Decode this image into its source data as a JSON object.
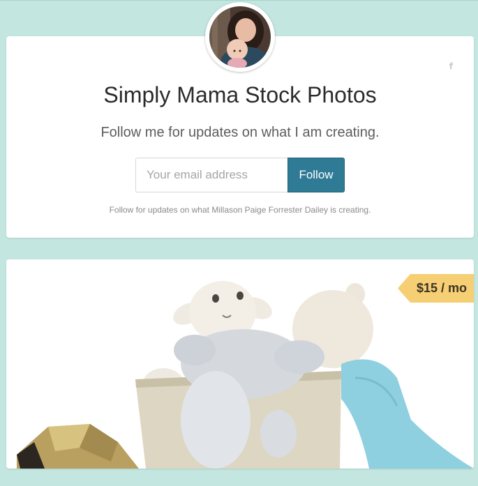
{
  "profile": {
    "title": "Simply Mama Stock Photos",
    "subtitle": "Follow me for updates on what I am creating.",
    "avatar_icon": "profile-photo",
    "social_icon": "facebook-icon",
    "social_glyph": "f"
  },
  "follow_form": {
    "email_placeholder": "Your email address",
    "email_value": "",
    "button_label": "Follow",
    "note": "Follow for updates on what Millason Paige Forrester Dailey is creating."
  },
  "tier": {
    "price_label": "$15 / mo",
    "image_icon": "plush-toys-photo"
  },
  "colors": {
    "background": "#c3e6e0",
    "button": "#2f7b96",
    "price_tag": "#f6cf75"
  }
}
